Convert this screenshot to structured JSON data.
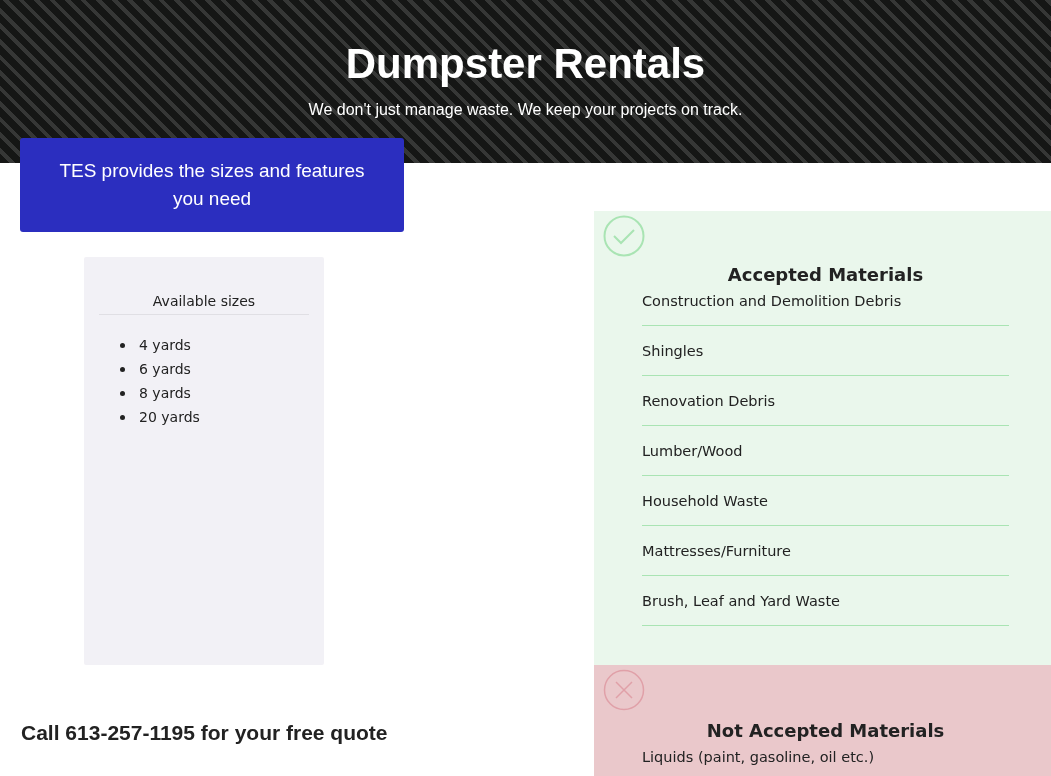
{
  "header": {
    "title": "Dumpster Rentals",
    "subtitle": "We don't just manage waste. We keep your projects on track."
  },
  "feature_button": {
    "label": "TES provides the sizes and features you need"
  },
  "sizes_card": {
    "title": "Available sizes",
    "items": [
      "4 yards",
      "6 yards",
      "8 yards",
      "20 yards"
    ]
  },
  "call_to_action": "Call 613-257-1195 for your free quote",
  "material_panels": [
    {
      "kind": "accepted",
      "title": "Accepted Materials",
      "items": [
        "Construction and Demolition Debris",
        "Shingles",
        "Renovation Debris",
        "Lumber/Wood",
        "Household Waste",
        "Mattresses/Furniture",
        "Brush, Leaf and Yard Waste"
      ]
    },
    {
      "kind": "not_accepted",
      "title": "Not Accepted Materials",
      "items": [
        "Liquids (paint, gasoline, oil etc.)"
      ]
    }
  ]
}
